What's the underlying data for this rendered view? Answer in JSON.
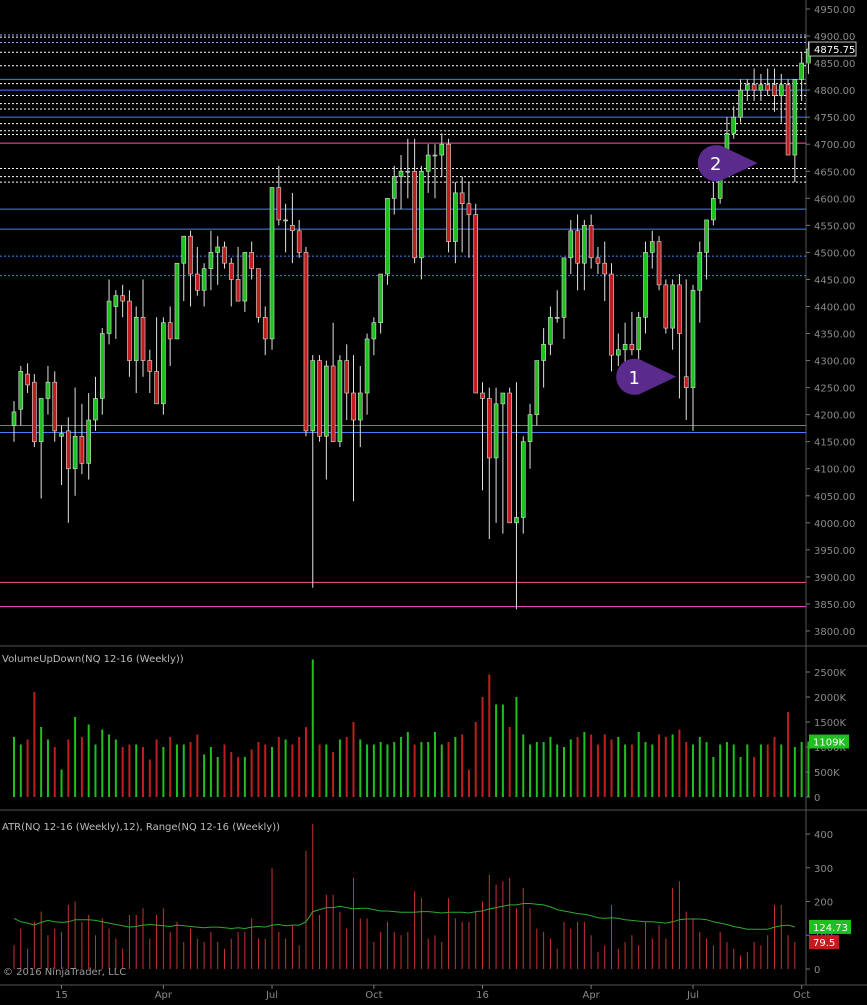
{
  "copyright": "© 2016 NinjaTrader, LLC",
  "x_labels": [
    "15",
    "Apr",
    "Jul",
    "Oct",
    "16",
    "Apr",
    "Jul",
    "Oct"
  ],
  "colors": {
    "up": "#1fbf1f",
    "down": "#c01e1e",
    "grid": "#2a2a2a",
    "axis_text": "#8a8a8a",
    "marker": "#5a2a8c",
    "atr_line": "#2fa82f"
  },
  "chart_data": [
    {
      "type": "candlestick",
      "name": "NQ 12-16 (Weekly)",
      "ylim": [
        3775,
        4950
      ],
      "y_ticks": [
        "3800.00",
        "3850.00",
        "3900.00",
        "3950.00",
        "4000.00",
        "4050.00",
        "4100.00",
        "4150.00",
        "4200.00",
        "4250.00",
        "4300.00",
        "4350.00",
        "4400.00",
        "4450.00",
        "4500.00",
        "4550.00",
        "4600.00",
        "4650.00",
        "4700.00",
        "4750.00",
        "4800.00",
        "4850.00",
        "4900.00",
        "4950.00"
      ],
      "last_value": "4875.75",
      "annotations": [
        {
          "label": "1",
          "x_index": 99,
          "price": 4270
        },
        {
          "label": "2",
          "x_index": 111,
          "price": 4665
        }
      ],
      "horizontal_levels": [
        {
          "price": 4902,
          "color": "#9aa4ff",
          "style": "dotted"
        },
        {
          "price": 4898,
          "color": "#ffffff",
          "style": "dotted"
        },
        {
          "price": 4888,
          "color": "#9aa4ff",
          "style": "dotted"
        },
        {
          "price": 4870,
          "color": "#ffffff",
          "style": "dotted"
        },
        {
          "price": 4845,
          "color": "#ffffff",
          "style": "dotted"
        },
        {
          "price": 4820,
          "color": "#4a7cff",
          "style": "solid"
        },
        {
          "price": 4812,
          "color": "#ffffff",
          "style": "dotted"
        },
        {
          "price": 4800,
          "color": "#4a7cff",
          "style": "solid"
        },
        {
          "price": 4790,
          "color": "#ffffff",
          "style": "dotted"
        },
        {
          "price": 4775,
          "color": "#ffffff",
          "style": "dotted"
        },
        {
          "price": 4765,
          "color": "#ffffff",
          "style": "dotted"
        },
        {
          "price": 4750,
          "color": "#4a7cff",
          "style": "solid"
        },
        {
          "price": 4738,
          "color": "#ffffff",
          "style": "dotted"
        },
        {
          "price": 4725,
          "color": "#ffffff",
          "style": "dotted"
        },
        {
          "price": 4718,
          "color": "#ffffff",
          "style": "dotted"
        },
        {
          "price": 4702,
          "color": "#ff4fb0",
          "style": "solid"
        },
        {
          "price": 4655,
          "color": "#ffffff",
          "style": "dotted"
        },
        {
          "price": 4640,
          "color": "#ffffff",
          "style": "dotted"
        },
        {
          "price": 4630,
          "color": "#ffffff",
          "style": "dotted"
        },
        {
          "price": 4580,
          "color": "#4a7cff",
          "style": "solid"
        },
        {
          "price": 4543,
          "color": "#4a7cff",
          "style": "solid"
        },
        {
          "price": 4493,
          "color": "#4a7cff",
          "style": "dotted"
        },
        {
          "price": 4457,
          "color": "#4a7cff",
          "style": "dotted"
        },
        {
          "price": 4180,
          "color": "#4a7cff",
          "style": "solid"
        },
        {
          "price": 4167,
          "color": "#4a7cff",
          "style": "solid"
        },
        {
          "price": 3890,
          "color": "#ff4f8a",
          "style": "solid"
        },
        {
          "price": 3845,
          "color": "#ff4fd0",
          "style": "solid"
        }
      ],
      "candles": [
        [
          4180,
          4225,
          4150,
          4205
        ],
        [
          4210,
          4290,
          4180,
          4280
        ],
        [
          4275,
          4295,
          4240,
          4255
        ],
        [
          4260,
          4275,
          4140,
          4150
        ],
        [
          4150,
          4220,
          4045,
          4230
        ],
        [
          4230,
          4290,
          4200,
          4260
        ],
        [
          4260,
          4280,
          4150,
          4170
        ],
        [
          4160,
          4180,
          4070,
          4165
        ],
        [
          4170,
          4195,
          4000,
          4100
        ],
        [
          4100,
          4250,
          4050,
          4160
        ],
        [
          4160,
          4220,
          4090,
          4110
        ],
        [
          4110,
          4240,
          4080,
          4190
        ],
        [
          4190,
          4270,
          4170,
          4230
        ],
        [
          4230,
          4360,
          4200,
          4350
        ],
        [
          4350,
          4450,
          4330,
          4410
        ],
        [
          4400,
          4430,
          4340,
          4420
        ],
        [
          4420,
          4440,
          4380,
          4410
        ],
        [
          4410,
          4430,
          4270,
          4300
        ],
        [
          4300,
          4400,
          4240,
          4380
        ],
        [
          4380,
          4450,
          4270,
          4300
        ],
        [
          4300,
          4320,
          4240,
          4280
        ],
        [
          4280,
          4380,
          4220,
          4220
        ],
        [
          4220,
          4380,
          4200,
          4370
        ],
        [
          4370,
          4400,
          4290,
          4340
        ],
        [
          4340,
          4480,
          4340,
          4480
        ],
        [
          4480,
          4530,
          4410,
          4530
        ],
        [
          4530,
          4540,
          4400,
          4460
        ],
        [
          4460,
          4510,
          4420,
          4430
        ],
        [
          4430,
          4480,
          4400,
          4470
        ],
        [
          4470,
          4540,
          4430,
          4500
        ],
        [
          4500,
          4530,
          4440,
          4510
        ],
        [
          4510,
          4520,
          4470,
          4480
        ],
        [
          4480,
          4490,
          4400,
          4450
        ],
        [
          4450,
          4510,
          4430,
          4410
        ],
        [
          4410,
          4500,
          4390,
          4500
        ],
        [
          4500,
          4520,
          4450,
          4470
        ],
        [
          4470,
          4470,
          4370,
          4380
        ],
        [
          4380,
          4400,
          4310,
          4340
        ],
        [
          4340,
          4620,
          4320,
          4620
        ],
        [
          4620,
          4660,
          4550,
          4560
        ],
        [
          4560,
          4590,
          4500,
          4560
        ],
        [
          4550,
          4610,
          4480,
          4540
        ],
        [
          4540,
          4560,
          4490,
          4500
        ],
        [
          4500,
          4510,
          4160,
          4170
        ],
        [
          4170,
          4310,
          3880,
          4300
        ],
        [
          4300,
          4310,
          4150,
          4160
        ],
        [
          4160,
          4300,
          4080,
          4290
        ],
        [
          4290,
          4370,
          4150,
          4150
        ],
        [
          4150,
          4310,
          4140,
          4300
        ],
        [
          4300,
          4330,
          4190,
          4240
        ],
        [
          4240,
          4310,
          4040,
          4190
        ],
        [
          4190,
          4290,
          4140,
          4240
        ],
        [
          4240,
          4350,
          4200,
          4340
        ],
        [
          4340,
          4380,
          4310,
          4370
        ],
        [
          4370,
          4460,
          4350,
          4460
        ],
        [
          4460,
          4600,
          4440,
          4600
        ],
        [
          4600,
          4660,
          4570,
          4640
        ],
        [
          4640,
          4680,
          4580,
          4650
        ],
        [
          4650,
          4710,
          4600,
          4650
        ],
        [
          4650,
          4710,
          4480,
          4490
        ],
        [
          4490,
          4660,
          4450,
          4650
        ],
        [
          4650,
          4700,
          4610,
          4680
        ],
        [
          4680,
          4700,
          4600,
          4680
        ],
        [
          4680,
          4720,
          4640,
          4700
        ],
        [
          4700,
          4710,
          4500,
          4520
        ],
        [
          4520,
          4630,
          4480,
          4610
        ],
        [
          4610,
          4640,
          4500,
          4590
        ],
        [
          4590,
          4630,
          4490,
          4570
        ],
        [
          4570,
          4590,
          4400,
          4240
        ],
        [
          4240,
          4260,
          4060,
          4230
        ],
        [
          4230,
          4250,
          3970,
          4120
        ],
        [
          4120,
          4250,
          4000,
          4220
        ],
        [
          4220,
          4240,
          3980,
          4240
        ],
        [
          4240,
          4250,
          4000,
          4000
        ],
        [
          4000,
          4260,
          3840,
          4010
        ],
        [
          4010,
          4160,
          3980,
          4150
        ],
        [
          4150,
          4220,
          4100,
          4200
        ],
        [
          4200,
          4300,
          4180,
          4300
        ],
        [
          4300,
          4360,
          4250,
          4330
        ],
        [
          4330,
          4400,
          4310,
          4380
        ],
        [
          4380,
          4430,
          4370,
          4380
        ],
        [
          4380,
          4480,
          4340,
          4490
        ],
        [
          4490,
          4560,
          4460,
          4540
        ],
        [
          4540,
          4570,
          4430,
          4480
        ],
        [
          4480,
          4560,
          4430,
          4550
        ],
        [
          4550,
          4570,
          4470,
          4490
        ],
        [
          4490,
          4510,
          4460,
          4480
        ],
        [
          4480,
          4520,
          4410,
          4460
        ],
        [
          4460,
          4480,
          4280,
          4310
        ],
        [
          4310,
          4350,
          4290,
          4320
        ],
        [
          4320,
          4370,
          4290,
          4330
        ],
        [
          4330,
          4390,
          4310,
          4320
        ],
        [
          4320,
          4390,
          4290,
          4380
        ],
        [
          4380,
          4520,
          4350,
          4500
        ],
        [
          4500,
          4540,
          4470,
          4520
        ],
        [
          4520,
          4530,
          4430,
          4440
        ],
        [
          4440,
          4450,
          4350,
          4360
        ],
        [
          4360,
          4450,
          4320,
          4440
        ],
        [
          4440,
          4460,
          4230,
          4350
        ],
        [
          4270,
          4450,
          4190,
          4250
        ],
        [
          4250,
          4440,
          4170,
          4430
        ],
        [
          4430,
          4520,
          4370,
          4500
        ],
        [
          4500,
          4560,
          4450,
          4560
        ],
        [
          4560,
          4630,
          4550,
          4600
        ],
        [
          4600,
          4690,
          4590,
          4680
        ],
        [
          4680,
          4750,
          4660,
          4720
        ],
        [
          4720,
          4770,
          4710,
          4750
        ],
        [
          4750,
          4820,
          4740,
          4800
        ],
        [
          4800,
          4820,
          4780,
          4810
        ],
        [
          4810,
          4840,
          4780,
          4800
        ],
        [
          4800,
          4830,
          4780,
          4810
        ],
        [
          4810,
          4840,
          4790,
          4800
        ],
        [
          4810,
          4840,
          4760,
          4790
        ],
        [
          4790,
          4830,
          4740,
          4810
        ],
        [
          4810,
          4820,
          4720,
          4680
        ],
        [
          4680,
          4820,
          4630,
          4820
        ],
        [
          4820,
          4870,
          4780,
          4850
        ],
        [
          4850,
          4890,
          4830,
          4876
        ]
      ]
    },
    {
      "type": "bar",
      "name": "VolumeUpDown(NQ 12-16 (Weekly))",
      "title": "VolumeUpDown(NQ 12-16 (Weekly))",
      "unit": "K",
      "ylim": [
        0,
        2800
      ],
      "y_ticks": [
        "0",
        "500K",
        "1000K",
        "1500K",
        "2000K",
        "2500K"
      ],
      "last_value": "1109K",
      "values": [
        1200,
        1050,
        1150,
        2100,
        1400,
        1150,
        1000,
        550,
        1150,
        1600,
        1200,
        1450,
        1050,
        1350,
        1250,
        1150,
        1000,
        1050,
        1050,
        1000,
        750,
        1150,
        1000,
        1200,
        1050,
        1050,
        1100,
        1250,
        850,
        1000,
        800,
        1050,
        900,
        800,
        800,
        950,
        1100,
        1050,
        1000,
        1200,
        1150,
        1050,
        1200,
        1400,
        2750,
        1050,
        1050,
        900,
        1150,
        1200,
        1500,
        1150,
        1050,
        1050,
        1100,
        1050,
        1100,
        1200,
        1300,
        1050,
        1100,
        1100,
        1300,
        1050,
        1100,
        1200,
        1250,
        550,
        1500,
        2000,
        2450,
        1850,
        1850,
        1400,
        2000,
        1250,
        1050,
        1100,
        1100,
        1200,
        1050,
        1000,
        1150,
        1200,
        1300,
        1250,
        1050,
        1250,
        1150,
        1200,
        1050,
        1050,
        1300,
        1100,
        1050,
        1250,
        1200,
        1250,
        1350,
        1100,
        1050,
        1200,
        1100,
        800,
        1050,
        1100,
        1050,
        800,
        1050,
        800,
        1050,
        1050,
        1200,
        1050,
        1700,
        1000,
        1100,
        1109
      ]
    },
    {
      "type": "bar",
      "name": "ATR(NQ 12-16 (Weekly),12), Range(NQ 12-16 (Weekly))",
      "title": "ATR(NQ 12-16 (Weekly),12), Range(NQ 12-16 (Weekly))",
      "ylim": [
        -20,
        450
      ],
      "y_ticks": [
        "0",
        "100",
        "200",
        "300",
        "400"
      ],
      "last_values": {
        "atr": "124.73",
        "range": "79.5"
      },
      "range_values": [
        70,
        120,
        60,
        140,
        170,
        100,
        120,
        110,
        190,
        200,
        140,
        160,
        100,
        150,
        120,
        90,
        60,
        160,
        160,
        180,
        90,
        160,
        180,
        110,
        140,
        80,
        120,
        90,
        80,
        110,
        80,
        60,
        90,
        110,
        110,
        150,
        90,
        90,
        300,
        110,
        90,
        130,
        70,
        350,
        430,
        160,
        220,
        220,
        170,
        120,
        270,
        150,
        150,
        80,
        110,
        140,
        110,
        100,
        110,
        230,
        210,
        90,
        100,
        80,
        210,
        150,
        140,
        140,
        170,
        200,
        280,
        250,
        260,
        270,
        180,
        240,
        180,
        120,
        110,
        90,
        60,
        140,
        120,
        140,
        140,
        100,
        50,
        70,
        190,
        60,
        80,
        100,
        70,
        140,
        90,
        130,
        90,
        240,
        260,
        170,
        150,
        110,
        90,
        70,
        110,
        80,
        60,
        40,
        50,
        80,
        70,
        100,
        190,
        190,
        100,
        80
      ],
      "atr_values": [
        150,
        140,
        136,
        130,
        138,
        144,
        140,
        138,
        140,
        146,
        146,
        146,
        144,
        140,
        136,
        132,
        128,
        124,
        126,
        130,
        132,
        130,
        128,
        126,
        130,
        128,
        126,
        124,
        122,
        124,
        124,
        122,
        120,
        122,
        120,
        124,
        126,
        124,
        130,
        132,
        128,
        130,
        130,
        140,
        170,
        176,
        182,
        182,
        186,
        182,
        178,
        180,
        180,
        176,
        172,
        172,
        170,
        168,
        168,
        168,
        170,
        170,
        168,
        166,
        168,
        168,
        168,
        166,
        170,
        172,
        178,
        182,
        186,
        190,
        190,
        194,
        194,
        192,
        190,
        184,
        176,
        172,
        168,
        164,
        162,
        158,
        152,
        150,
        152,
        150,
        146,
        144,
        142,
        140,
        140,
        138,
        136,
        140,
        146,
        148,
        148,
        148,
        146,
        140,
        136,
        132,
        126,
        122,
        118,
        118,
        118,
        118,
        124,
        128,
        130,
        124.73
      ]
    }
  ]
}
